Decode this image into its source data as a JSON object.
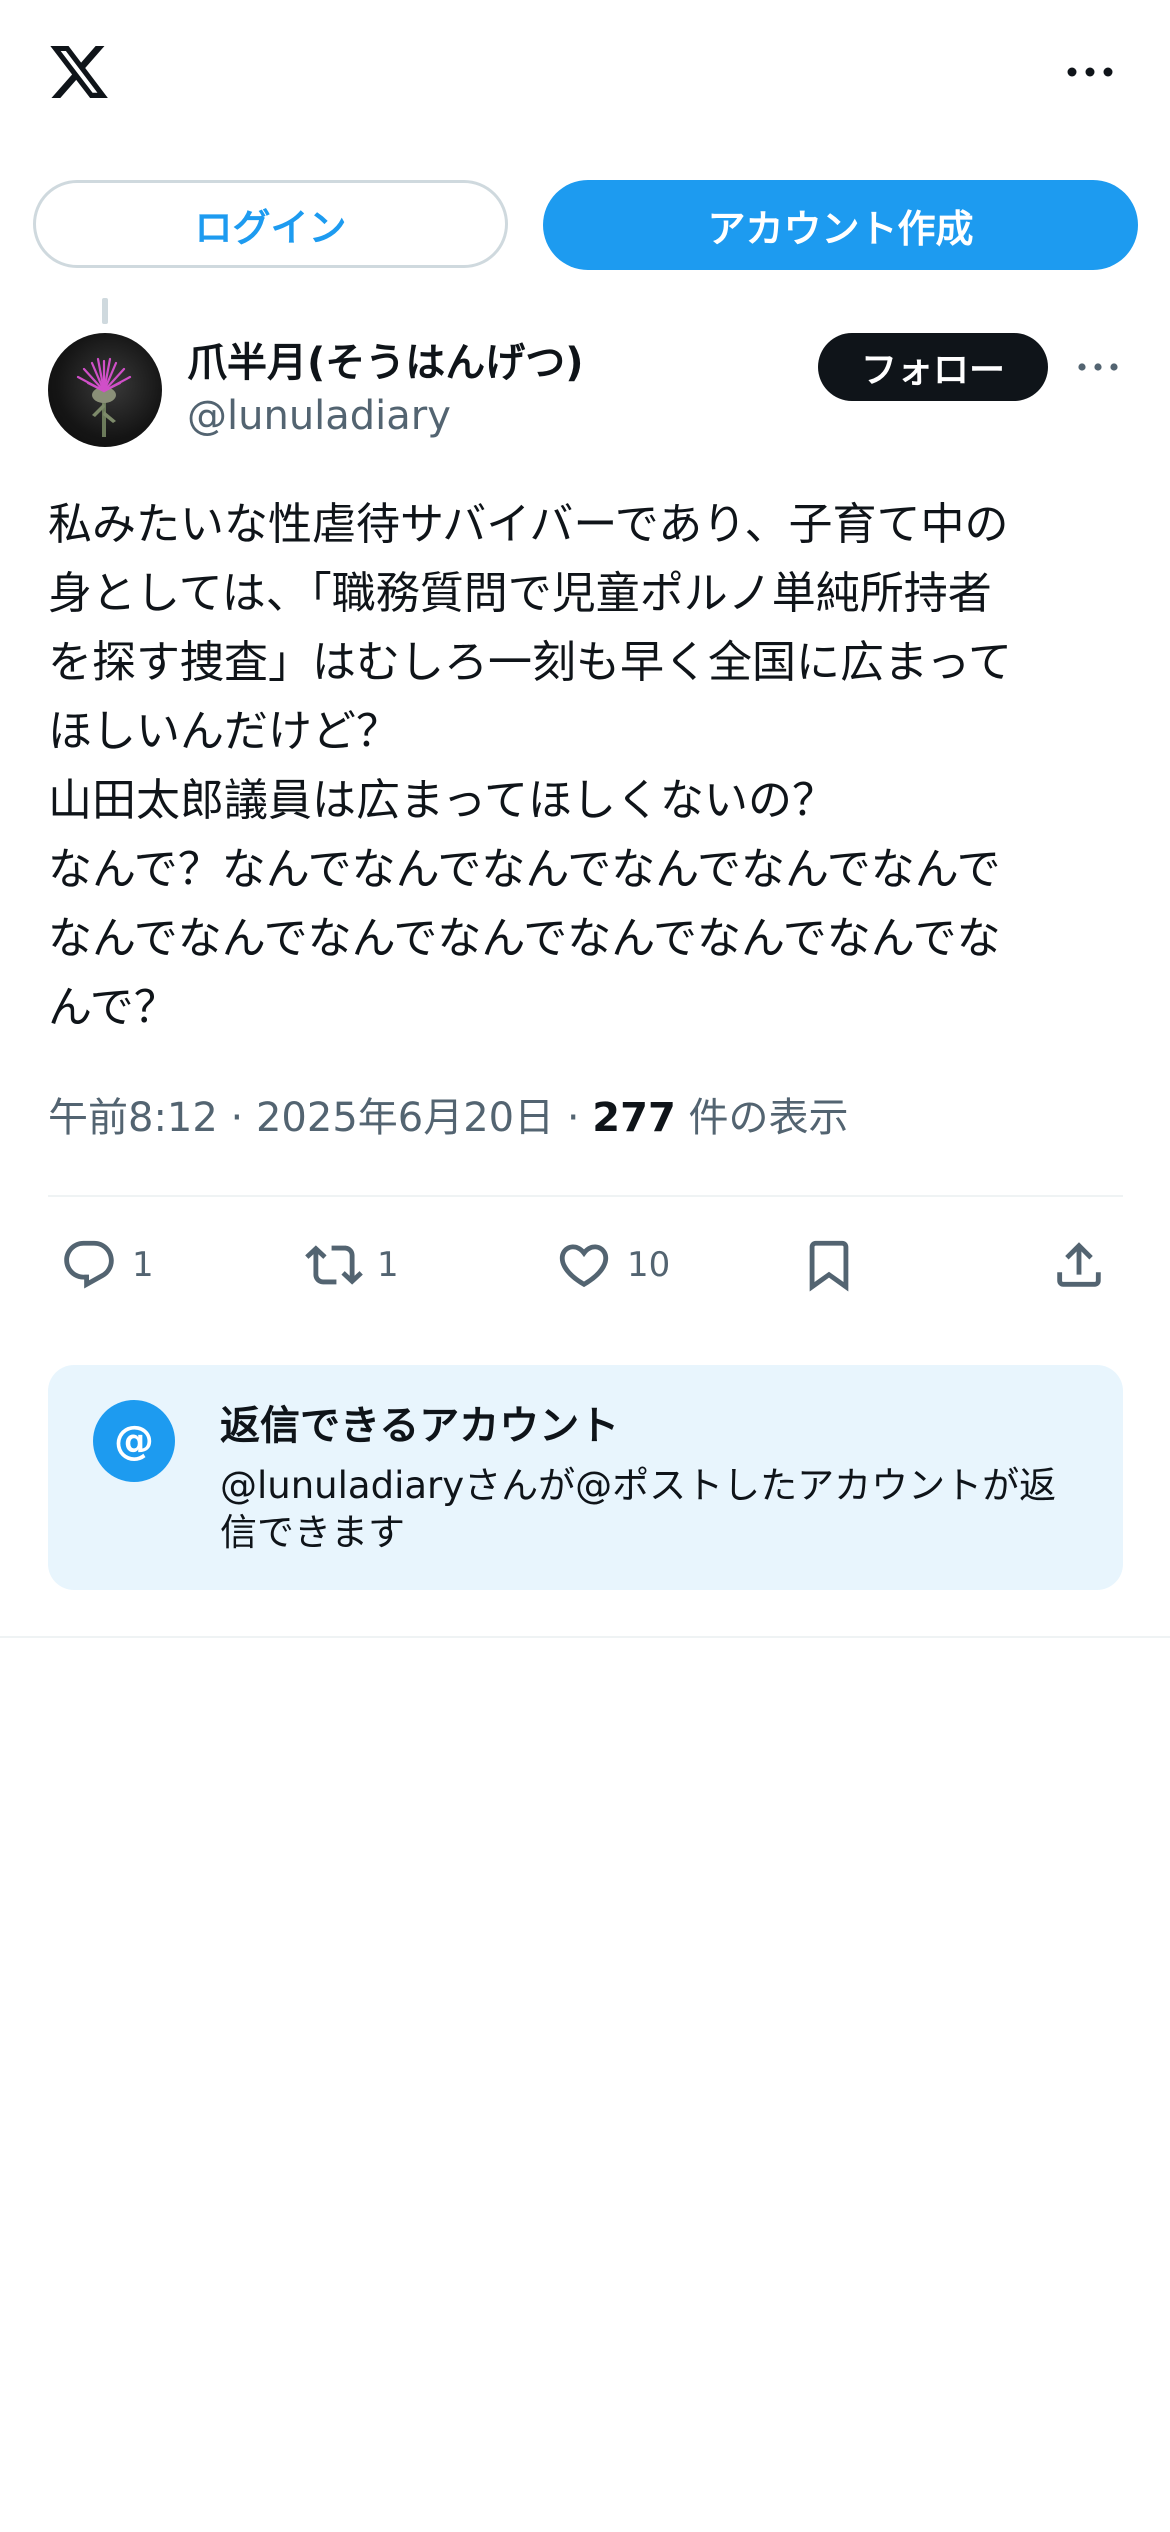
{
  "topbar": {
    "logo_icon": "x-logo-icon",
    "more_icon": "more-horizontal-icon"
  },
  "auth": {
    "login_label": "ログイン",
    "signup_label": "アカウント作成"
  },
  "post": {
    "author": {
      "display_name": "爪半月(そうはんげつ)",
      "handle": "@lunuladiary",
      "follow_label": "フォロー"
    },
    "text_lines": [
      "私みたいな性虐待サバイバーであり、子育て中の",
      "身としては、「職務質問で児童ポルノ単純所持者",
      "を探す捜査」はむしろ一刻も早く全国に広まって",
      "ほしいんだけど？",
      "山田太郎議員は広まってほしくないの？",
      "なんで？なんでなんでなんでなんでなんでなんで",
      "なんでなんでなんでなんでなんでなんでなんでな",
      "んで？"
    ],
    "meta": {
      "time": "午前8:12",
      "sep1": " · ",
      "date": "2025年6月20日",
      "sep2": " · ",
      "views_count": "277",
      "views_label": " 件の表示"
    },
    "actions": {
      "reply_count": "1",
      "repost_count": "1",
      "like_count": "10"
    }
  },
  "reply_info": {
    "icon_text": "@",
    "title": "返信できるアカウント",
    "body": "@lunuladiaryさんが@ポストしたアカウントが返信できます"
  },
  "colors": {
    "accent": "#1d9bf0",
    "text": "#0f1419",
    "muted": "#536471",
    "card_bg": "#e8f5fd"
  }
}
